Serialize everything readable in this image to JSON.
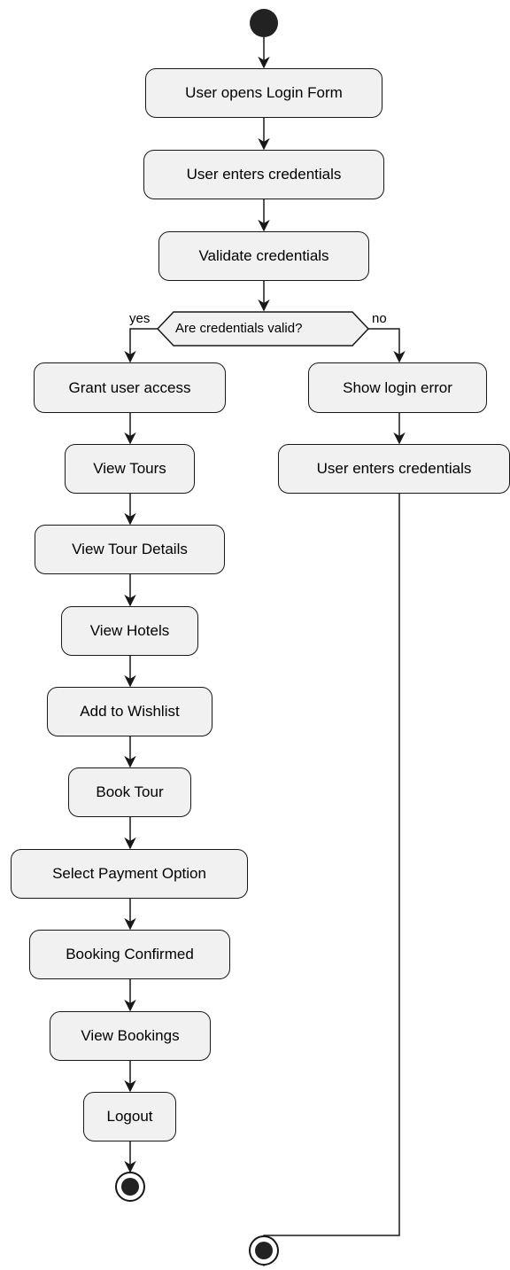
{
  "diagram": {
    "start_label": "",
    "nodes": {
      "open_login": "User opens Login Form",
      "enter_credentials": "User enters credentials",
      "validate": "Validate credentials",
      "grant_access": "Grant user access",
      "view_tours": "View Tours",
      "view_tour_details": "View Tour Details",
      "view_hotels": "View Hotels",
      "add_wishlist": "Add to Wishlist",
      "book_tour": "Book Tour",
      "select_payment": "Select Payment Option",
      "booking_confirmed": "Booking Confirmed",
      "view_bookings": "View Bookings",
      "logout": "Logout",
      "show_error": "Show login error",
      "reenter_credentials": "User enters credentials"
    },
    "decision": {
      "question": "Are credentials valid?",
      "yes_label": "yes",
      "no_label": "no"
    },
    "colors": {
      "node_fill": "#f1f1f1",
      "stroke": "#181818",
      "start": "#222222"
    }
  }
}
